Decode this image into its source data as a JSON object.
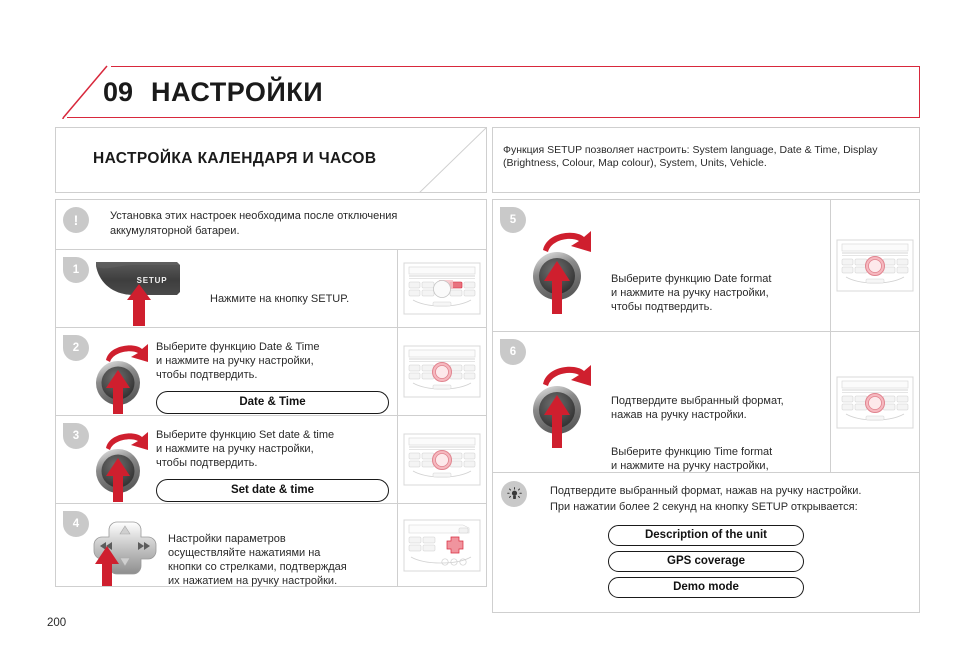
{
  "header": {
    "chapter_number": "09",
    "chapter_title": "НАСТРОЙКИ",
    "accent_color": "#d8283c"
  },
  "section": {
    "title": "НАСТРОЙКА КАЛЕНДАРЯ И ЧАСОВ",
    "description": "Функция SETUP позволяет настроить: System language, Date & Time, Display (Brightness, Colour, Map colour), System, Units, Vehicle."
  },
  "note": {
    "icon": "exclamation-icon",
    "text": "Установка этих настроек необходима после отключения аккумуляторной батареи."
  },
  "steps_left": [
    {
      "number": "1",
      "graphic": "setup-button-graphic",
      "setup_label": "SETUP",
      "lines": [
        "Нажмите на кнопку SETUP."
      ],
      "pill": null,
      "thumb": "radio-unit-setup-highlight"
    },
    {
      "number": "2",
      "graphic": "rotary-knob-graphic",
      "lines": [
        "Выберите функцию Date & Time\nи нажмите на ручку настройки,\nчтобы подтвердить."
      ],
      "pill": "Date & Time",
      "thumb": "radio-unit-knob-highlight"
    },
    {
      "number": "3",
      "graphic": "rotary-knob-graphic",
      "lines": [
        "Выберите функцию Set date & time\nи нажмите на ручку настройки,\nчтобы подтвердить."
      ],
      "pill": "Set date & time",
      "thumb": "radio-unit-knob-highlight"
    },
    {
      "number": "4",
      "graphic": "dpad-graphic",
      "lines": [
        "Настройки параметров\nосуществляйте нажатиями на\nкнопки со стрелками, подтверждая\nих нажатием на ручку настройки."
      ],
      "pill": null,
      "thumb": "radio-unit-dpad-highlight"
    }
  ],
  "steps_right": [
    {
      "number": "5",
      "graphic": "rotary-knob-graphic",
      "lines": [
        "Выберите функцию Date format\nи нажмите на ручку настройки,\nчтобы подтвердить."
      ],
      "pill": null,
      "thumb": "radio-unit-knob-highlight"
    },
    {
      "number": "6",
      "graphic": "rotary-knob-graphic",
      "lines": [
        "Подтвердите выбранный формат,\nнажав на ручку настройки.",
        "Выберите функцию Time format\nи нажмите на ручку настройки,\nчтобы подтвердить."
      ],
      "pill": null,
      "thumb": "radio-unit-knob-highlight"
    }
  ],
  "tip": {
    "icon": "lightbulb-icon",
    "line1": "Подтвердите выбранный формат, нажав на ручку настройки.",
    "line2": "При нажатии более 2 секунд на кнопку SETUP открывается:",
    "options": [
      "Description of the unit",
      "GPS coverage",
      "Demo mode"
    ]
  },
  "footer": {
    "page_number": "200"
  }
}
